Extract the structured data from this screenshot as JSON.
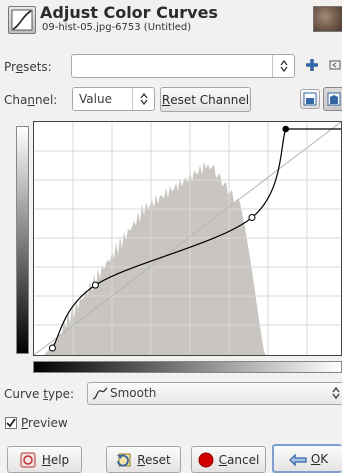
{
  "header": {
    "title": "Adjust Color Curves",
    "subtitle": "09-hist-05.jpg-6753 (Untitled)"
  },
  "presets": {
    "label": "Presets:",
    "value": ""
  },
  "channel": {
    "label": "Channel:",
    "value": "Value",
    "reset_label": "Reset Channel"
  },
  "curve_type": {
    "label": "Curve type:",
    "value": "Smooth"
  },
  "preview": {
    "label": "Preview",
    "checked": true
  },
  "buttons": {
    "help": "Help",
    "reset": "Reset",
    "cancel": "Cancel",
    "ok": "OK"
  },
  "curve_points": [
    [
      0.06,
      0.03
    ],
    [
      0.2,
      0.3
    ],
    [
      0.71,
      0.59
    ],
    [
      0.82,
      0.97
    ]
  ],
  "colors": {
    "histogram": "#c9c6c1",
    "curve": "#000000",
    "cancel_icon": "#d40000",
    "ok_icon": "#3465a4",
    "add_icon": "#3465a4"
  }
}
